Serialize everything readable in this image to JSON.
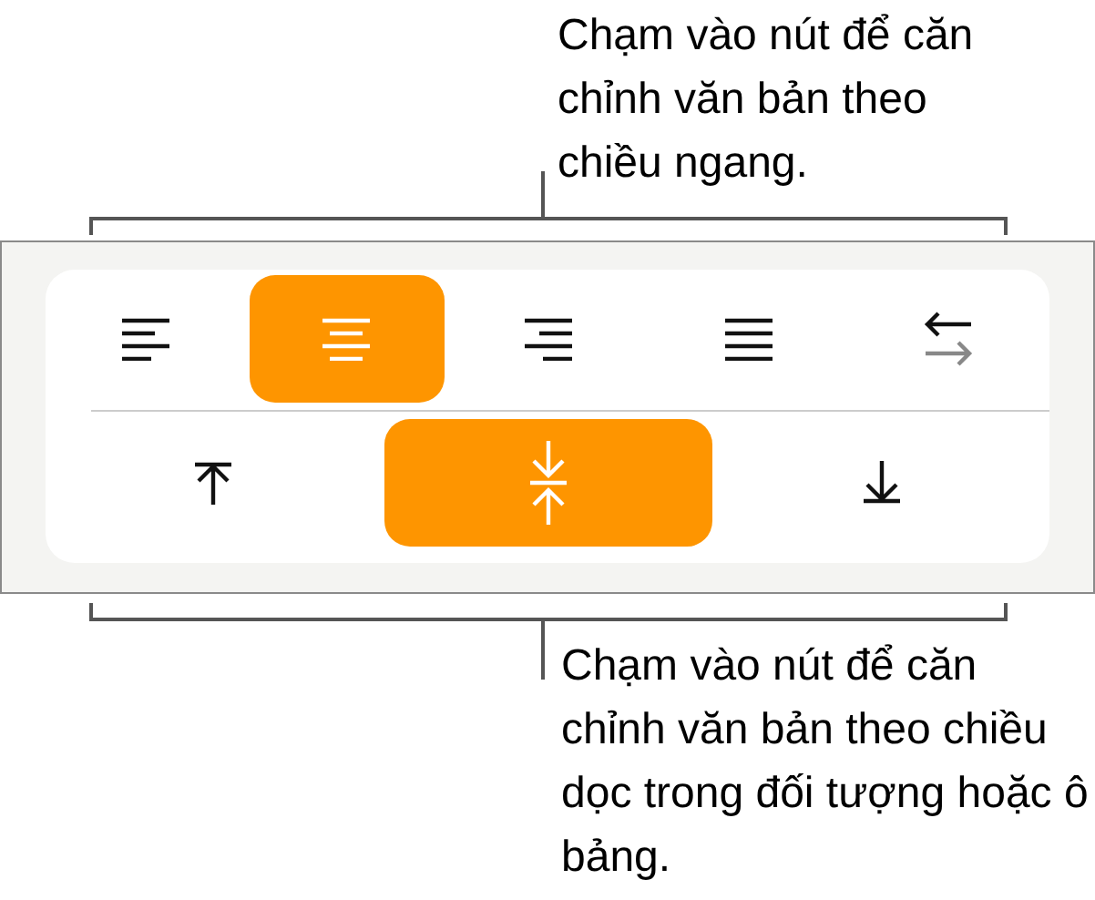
{
  "top_callout": "Chạm vào nút để căn chỉnh văn bản theo chiều ngang.",
  "horizontal_alignment": [
    {
      "kind": "left",
      "selected": false
    },
    {
      "kind": "center",
      "selected": true
    },
    {
      "kind": "right",
      "selected": false
    },
    {
      "kind": "justify",
      "selected": false
    },
    {
      "kind": "direction",
      "selected": false
    }
  ],
  "vertical_alignment": [
    {
      "kind": "top",
      "selected": false
    },
    {
      "kind": "middle",
      "selected": true
    },
    {
      "kind": "bottom",
      "selected": false
    }
  ],
  "bottom_callout": "Chạm vào nút để căn chỉnh văn bản theo chiều dọc trong đối tượng hoặc ô bảng."
}
